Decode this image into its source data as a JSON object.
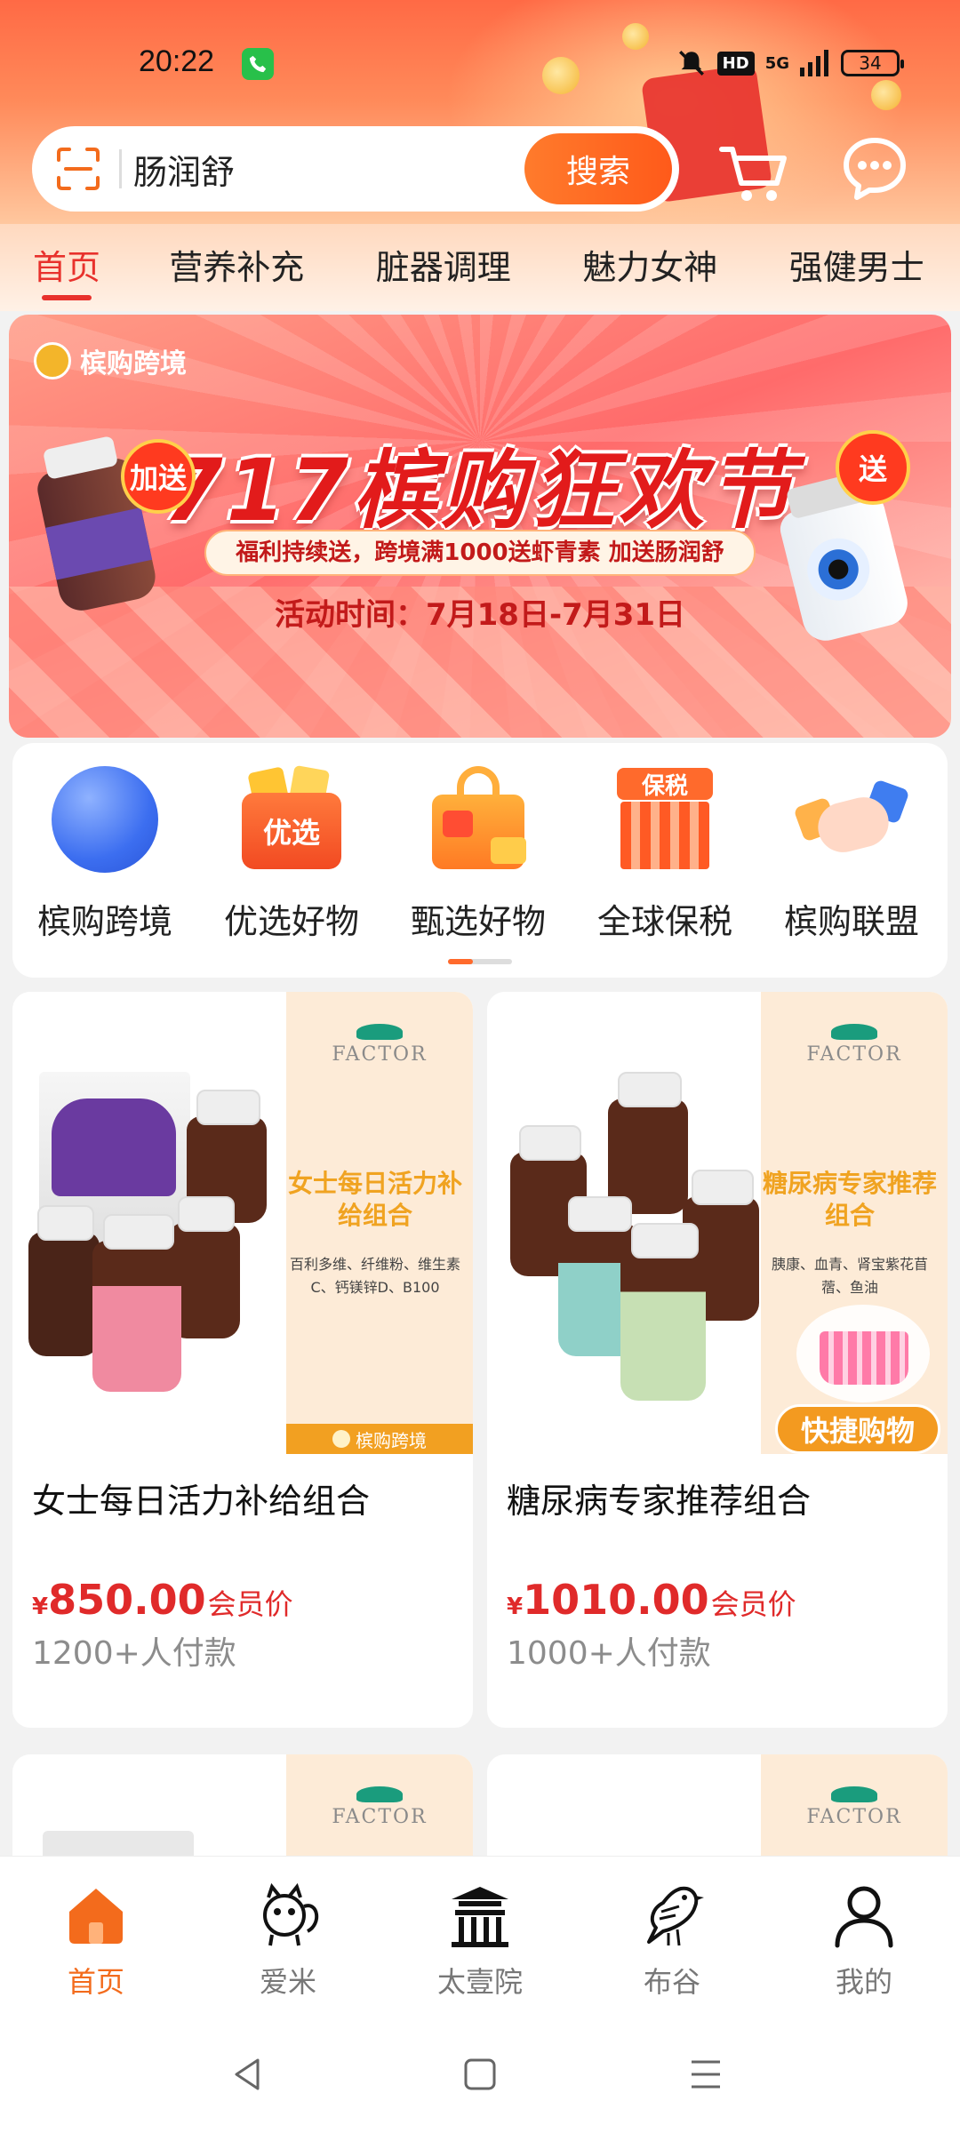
{
  "status_bar": {
    "time": "20:22",
    "hd": "HD",
    "network": "5G",
    "battery": "34"
  },
  "search": {
    "value": "肠润舒",
    "button": "搜索"
  },
  "tabs": [
    {
      "label": "首页"
    },
    {
      "label": "营养补充"
    },
    {
      "label": "脏器调理"
    },
    {
      "label": "魅力女神"
    },
    {
      "label": "强健男士"
    }
  ],
  "banner": {
    "brand": "槟购跨境",
    "title": "717槟购狂欢节",
    "subtitle": "福利持续送，跨境满1000送虾青素 加送肠润舒",
    "date": "活动时间：7月18日-7月31日",
    "badge_left": "加送",
    "badge_right": "送"
  },
  "quick_links": [
    {
      "label": "槟购跨境",
      "icon": "globe-icon"
    },
    {
      "label": "优选好物",
      "icon": "youxuan-icon",
      "icon_text": "优选"
    },
    {
      "label": "甄选好物",
      "icon": "shopping-bag-icon"
    },
    {
      "label": "全球保税",
      "icon": "bonded-store-icon",
      "icon_text": "保税"
    },
    {
      "label": "槟购联盟",
      "icon": "handshake-icon"
    }
  ],
  "products": [
    {
      "name": "女士每日活力补给组合",
      "currency": "¥",
      "price": "850.00",
      "price_label": "会员价",
      "sold": "1200+人付款",
      "brand": "FACTOR",
      "promo_title": "女士每日活力补给组合",
      "promo_desc": "百利多维、纤维粉、维生素C、钙镁锌D、B100",
      "strip": "槟购跨境"
    },
    {
      "name": "糖尿病专家推荐组合",
      "currency": "¥",
      "price": "1010.00",
      "price_label": "会员价",
      "sold": "1000+人付款",
      "brand": "FACTOR",
      "promo_title": "糖尿病专家推荐组合",
      "promo_desc": "胰康、血青、肾宝紫花苜蓿、鱼油",
      "quick_buy": "快捷购物"
    }
  ],
  "next_row_brand": "FACTOR",
  "bottom_nav": [
    {
      "label": "首页",
      "icon": "home-icon",
      "active": true
    },
    {
      "label": "爱米",
      "icon": "squirrel-icon"
    },
    {
      "label": "太壹院",
      "icon": "pavilion-icon"
    },
    {
      "label": "布谷",
      "icon": "bird-icon"
    },
    {
      "label": "我的",
      "icon": "person-icon"
    }
  ],
  "colors": {
    "accent": "#e8312c",
    "orange": "#f36b1c",
    "price": "#e02a2a"
  }
}
